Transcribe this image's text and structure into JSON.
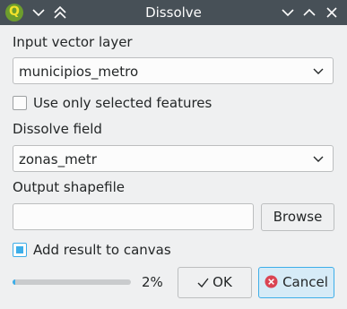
{
  "window": {
    "title": "Dissolve",
    "app_icon_glyph": "Q",
    "titlebar_left_icons": [
      "chevron-down-icon",
      "double-chevron-up-icon"
    ],
    "titlebar_right_icons": [
      "minimize-chevron-icon",
      "maximize-chevron-icon",
      "close-icon"
    ]
  },
  "form": {
    "input_layer_label": "Input vector layer",
    "input_layer_value": "municipios_metro",
    "selected_only_label": "Use only selected features",
    "selected_only_checked": false,
    "dissolve_field_label": "Dissolve field",
    "dissolve_field_value": "zonas_metr",
    "output_label": "Output shapefile",
    "output_value": "",
    "browse_label": "Browse",
    "add_to_canvas_label": "Add result to canvas",
    "add_to_canvas_checked": true
  },
  "footer": {
    "progress_percent": 2,
    "progress_text": "2%",
    "ok_label": "OK",
    "cancel_label": "Cancel"
  },
  "colors": {
    "titlebar": "#475057",
    "accent": "#3daee9",
    "cancel_icon": "#da4453"
  }
}
